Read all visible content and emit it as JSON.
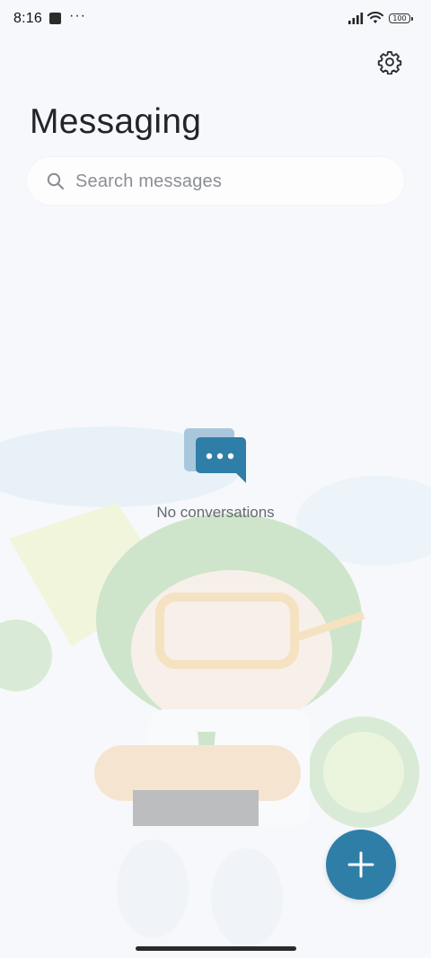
{
  "status_bar": {
    "time": "8:16",
    "dots": "···",
    "battery": "100"
  },
  "header": {
    "title": "Messaging",
    "settings_icon": "gear-icon"
  },
  "search": {
    "placeholder": "Search messages",
    "icon": "search-icon"
  },
  "empty_state": {
    "icon": "chat-bubbles-icon",
    "text": "No conversations"
  },
  "fab": {
    "icon": "plus-icon"
  },
  "colors": {
    "accent": "#2f7ea7",
    "background": "#f6f8fb"
  }
}
